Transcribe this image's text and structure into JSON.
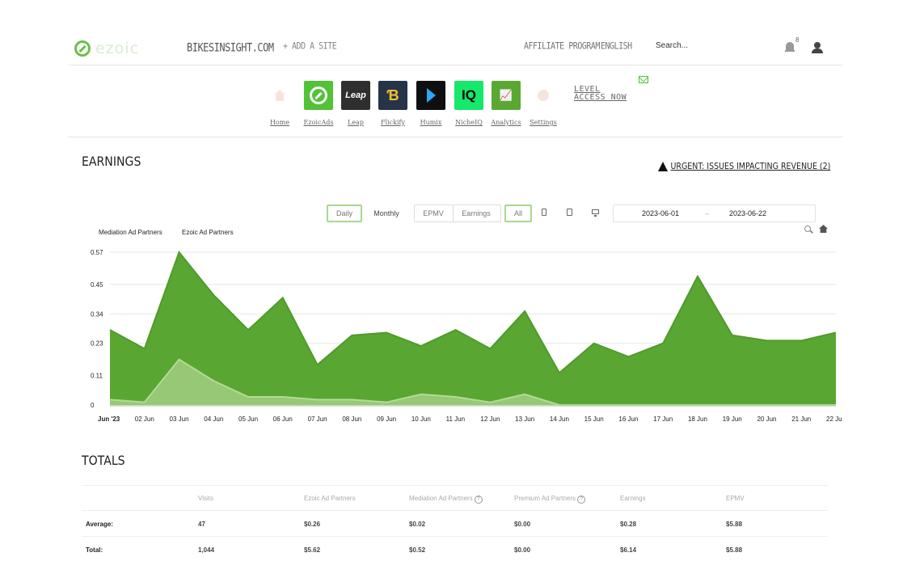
{
  "topnav": {
    "logo_text": "ezoic",
    "site": "BIKESINSIGHT.COM",
    "add_site": "+ ADD A SITE",
    "affiliate": "AFFILIATE PROGRAM",
    "language": "ENGLISH",
    "search_placeholder": "Search...",
    "notifications_count": "8"
  },
  "apps": [
    {
      "label": "Home",
      "icon": "home-icon"
    },
    {
      "label": "EzoicAds",
      "icon": "ezoic-icon"
    },
    {
      "label": "Leap",
      "tile_text": "Leap"
    },
    {
      "label": "Flickify",
      "tile_text": "Ɓ"
    },
    {
      "label": "Humix",
      "icon": "play-icon"
    },
    {
      "label": "NicheIQ",
      "tile_text": "IQ"
    },
    {
      "label": "Analytics",
      "tile_text": "📈"
    },
    {
      "label": "Settings",
      "icon": "gear-icon"
    }
  ],
  "level": {
    "line1": "LEVEL",
    "line2": "ACCESS NOW"
  },
  "earnings": {
    "title": "EARNINGS",
    "urgent": "URGENT: ISSUES IMPACTING REVENUE (2)"
  },
  "controls": {
    "daily": "Daily",
    "monthly": "Monthly",
    "epmv": "EPMV",
    "earnings": "Earnings",
    "all": "All",
    "date_start": "2023-06-01",
    "date_sep": "–",
    "date_end": "2023-06-22"
  },
  "colors": {
    "primary": "#5aa632",
    "secondary": "#9ccc7c",
    "accent": "#52c236"
  },
  "chart_data": {
    "type": "area",
    "legend": [
      "Mediation Ad Partners",
      "Ezoic Ad Partners"
    ],
    "legend_placement": "top-left",
    "x": [
      "Jun '23",
      "02 Jun",
      "03 Jun",
      "04 Jun",
      "05 Jun",
      "06 Jun",
      "07 Jun",
      "08 Jun",
      "09 Jun",
      "10 Jun",
      "11 Jun",
      "12 Jun",
      "13 Jun",
      "14 Jun",
      "15 Jun",
      "16 Jun",
      "17 Jun",
      "18 Jun",
      "19 Jun",
      "20 Jun",
      "21 Jun",
      "22 Ju"
    ],
    "yticks": [
      "0",
      "0.11",
      "0.23",
      "0.34",
      "0.45",
      "0.57"
    ],
    "ylim": [
      0,
      0.57
    ],
    "grid": true,
    "series": [
      {
        "name": "Ezoic Ad Partners",
        "color": "#5aa632",
        "values": [
          0.28,
          0.21,
          0.57,
          0.41,
          0.28,
          0.4,
          0.15,
          0.26,
          0.27,
          0.22,
          0.28,
          0.21,
          0.35,
          0.12,
          0.23,
          0.18,
          0.23,
          0.48,
          0.26,
          0.24,
          0.24,
          0.27
        ]
      },
      {
        "name": "Mediation Ad Partners",
        "color": "#9ccc7c",
        "values": [
          0.02,
          0.01,
          0.17,
          0.09,
          0.03,
          0.03,
          0.02,
          0.02,
          0.01,
          0.04,
          0.03,
          0.01,
          0.04,
          0.0,
          0.0,
          0.0,
          0.0,
          0.0,
          0.0,
          0.0,
          0.0,
          0.0
        ]
      }
    ]
  },
  "totals": {
    "title": "TOTALS",
    "columns": [
      "",
      "Visits",
      "Ezoic Ad Partners",
      "Mediation Ad Partners",
      "Premium Ad Partners",
      "Earnings",
      "EPMV"
    ],
    "rows": [
      [
        "Average:",
        "47",
        "$0.26",
        "$0.02",
        "$0.00",
        "$0.28",
        "$5.88"
      ],
      [
        "Total:",
        "1,044",
        "$5.62",
        "$0.52",
        "$0.00",
        "$6.14",
        "$5.88"
      ]
    ],
    "help_mark": "?"
  }
}
